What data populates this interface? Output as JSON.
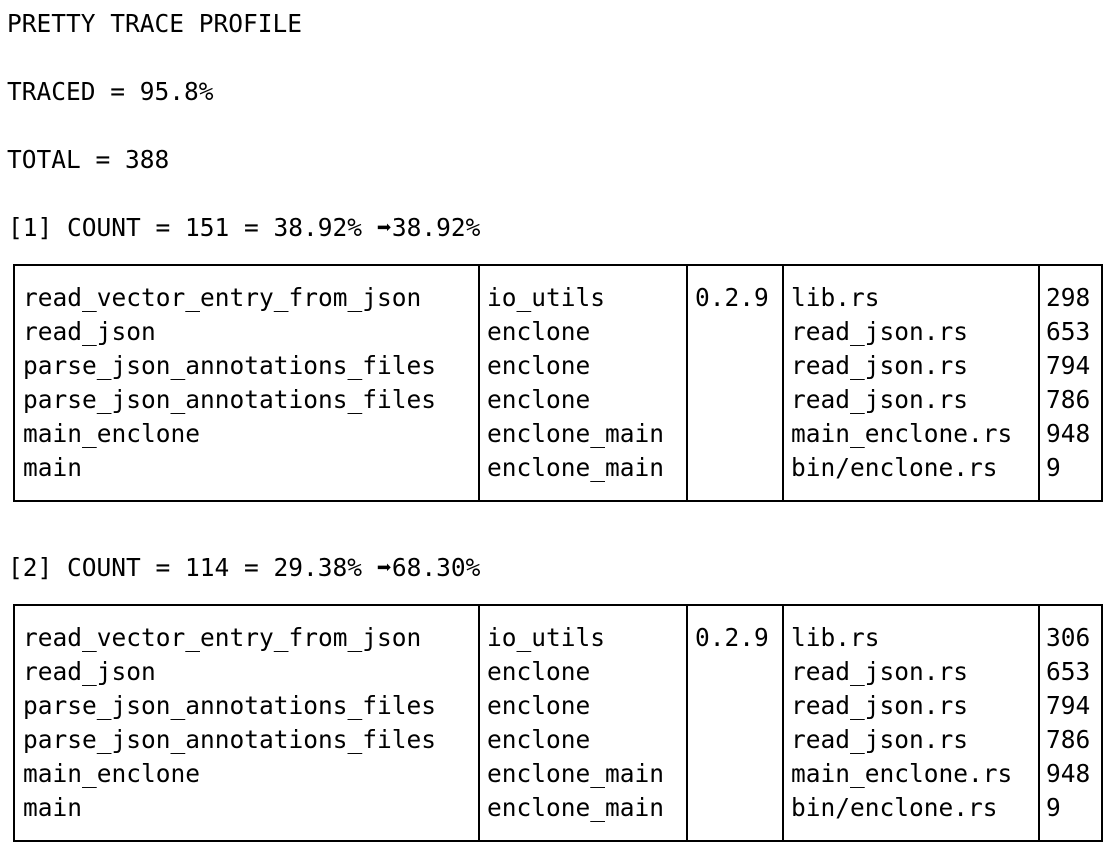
{
  "profile": {
    "title": "PRETTY TRACE PROFILE",
    "traced": "TRACED = 95.8%",
    "total": "TOTAL = 388"
  },
  "traces": [
    {
      "header_prefix": "[1] COUNT = 151 = 38.92% ",
      "arrow": "➡",
      "cumulative": "38.92%",
      "rows": [
        {
          "function": "read_vector_entry_from_json",
          "crate": "io_utils",
          "version": "0.2.9",
          "file": "lib.rs",
          "line": "298"
        },
        {
          "function": "read_json",
          "crate": "enclone",
          "version": "",
          "file": "read_json.rs",
          "line": "653"
        },
        {
          "function": "parse_json_annotations_files",
          "crate": "enclone",
          "version": "",
          "file": "read_json.rs",
          "line": "794"
        },
        {
          "function": "parse_json_annotations_files",
          "crate": "enclone",
          "version": "",
          "file": "read_json.rs",
          "line": "786"
        },
        {
          "function": "main_enclone",
          "crate": "enclone_main",
          "version": "",
          "file": "main_enclone.rs",
          "line": "948"
        },
        {
          "function": "main",
          "crate": "enclone_main",
          "version": "",
          "file": "bin/enclone.rs",
          "line": "9"
        }
      ]
    },
    {
      "header_prefix": "[2] COUNT = 114 = 29.38% ",
      "arrow": "➡",
      "cumulative": "68.30%",
      "rows": [
        {
          "function": "read_vector_entry_from_json",
          "crate": "io_utils",
          "version": "0.2.9",
          "file": "lib.rs",
          "line": "306"
        },
        {
          "function": "read_json",
          "crate": "enclone",
          "version": "",
          "file": "read_json.rs",
          "line": "653"
        },
        {
          "function": "parse_json_annotations_files",
          "crate": "enclone",
          "version": "",
          "file": "read_json.rs",
          "line": "794"
        },
        {
          "function": "parse_json_annotations_files",
          "crate": "enclone",
          "version": "",
          "file": "read_json.rs",
          "line": "786"
        },
        {
          "function": "main_enclone",
          "crate": "enclone_main",
          "version": "",
          "file": "main_enclone.rs",
          "line": "948"
        },
        {
          "function": "main",
          "crate": "enclone_main",
          "version": "",
          "file": "bin/enclone.rs",
          "line": "9"
        }
      ]
    }
  ]
}
